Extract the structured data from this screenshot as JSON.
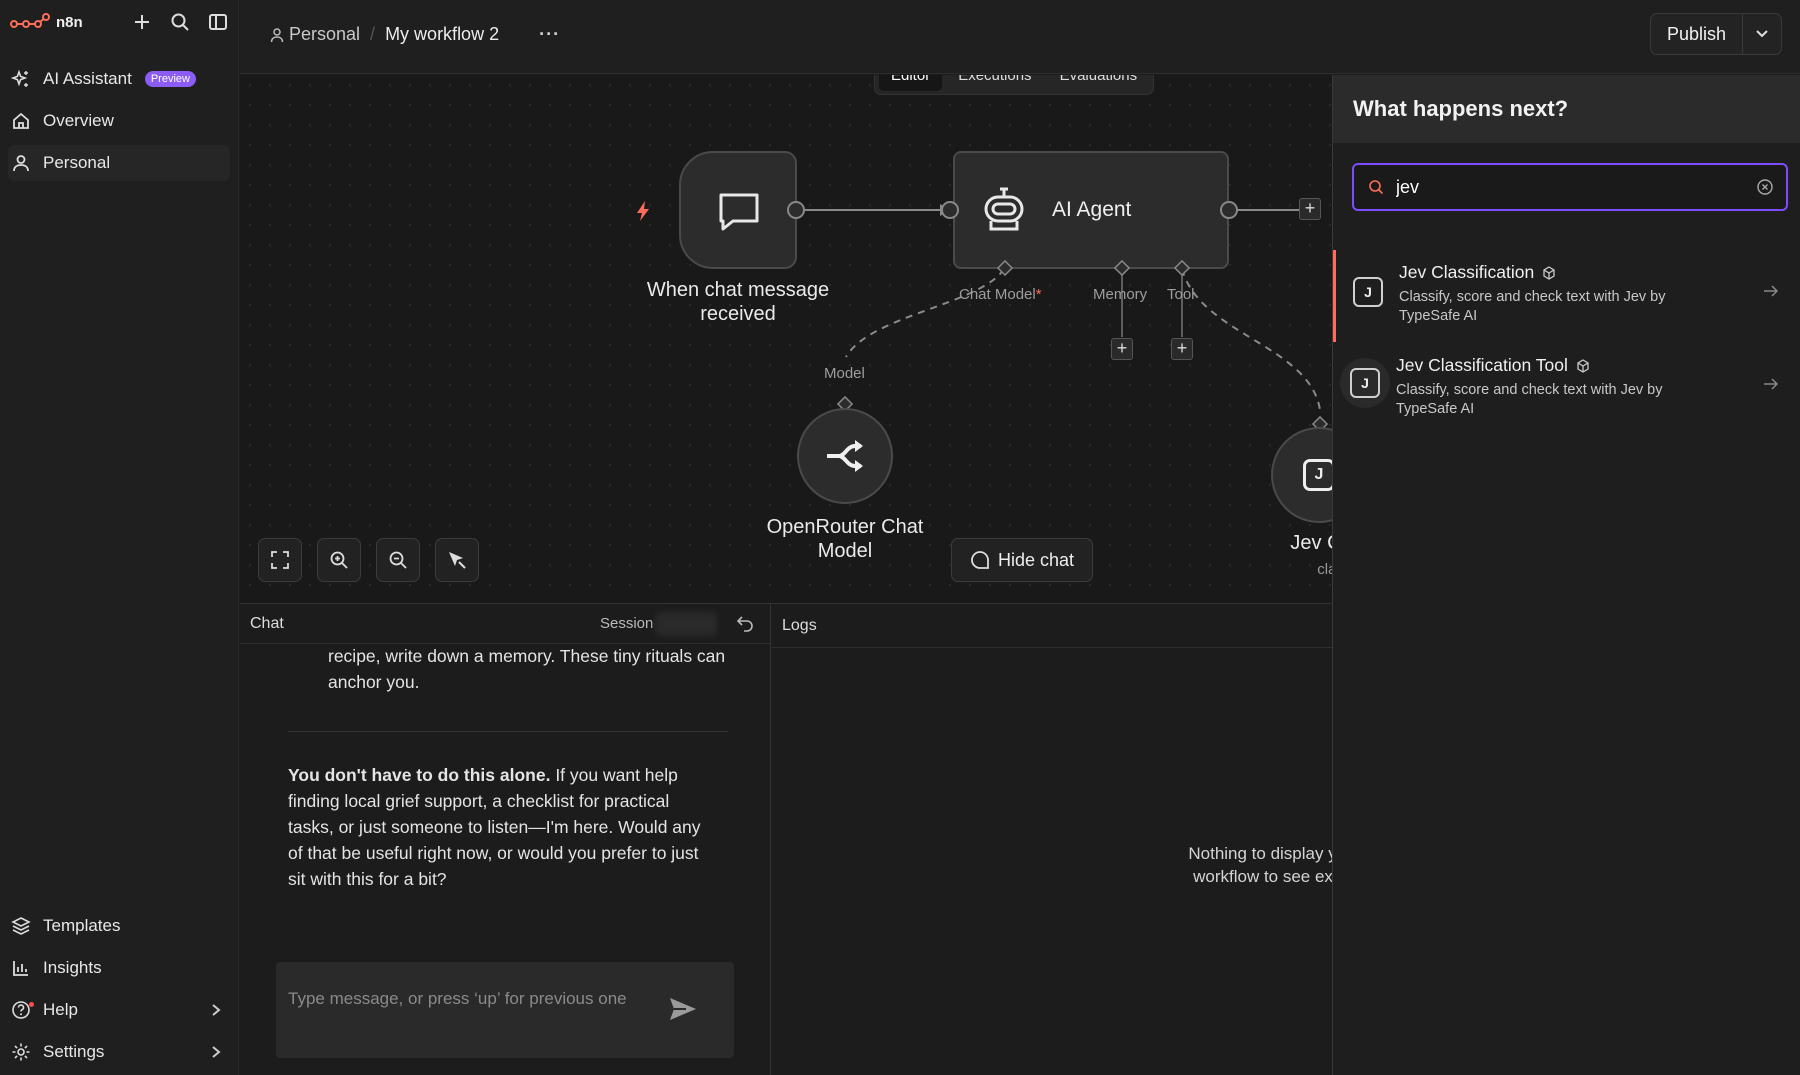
{
  "app": {
    "brand": "n8n",
    "accent_color": "#ff6d5a",
    "focus_color": "#7c4dff"
  },
  "sidebar": {
    "top_icons": [
      "plus-icon",
      "search-icon",
      "panel-toggle-icon"
    ],
    "items": [
      {
        "label": "AI Assistant",
        "badge": "Preview",
        "icon": "sparkle-icon"
      },
      {
        "label": "Overview",
        "icon": "home-icon"
      },
      {
        "label": "Personal",
        "icon": "user-icon"
      }
    ],
    "bottom_items": [
      {
        "label": "Templates",
        "icon": "templates-icon"
      },
      {
        "label": "Insights",
        "icon": "chart-icon"
      },
      {
        "label": "Help",
        "icon": "help-icon"
      },
      {
        "label": "Settings",
        "icon": "gear-icon"
      }
    ]
  },
  "header": {
    "project": "Personal",
    "workflow_name": "My workflow 2",
    "more": "···",
    "publish_label": "Publish"
  },
  "tabs": [
    "Editor",
    "Executions",
    "Evaluations"
  ],
  "canvas": {
    "nodes": {
      "trigger": "When chat message received",
      "agent": "AI Agent",
      "model": "OpenRouter Chat Model",
      "jev": "Jev Classi",
      "jev_sub": "classi"
    },
    "ports": {
      "chat_model": "Chat Model",
      "memory": "Memory",
      "tool": "Tool",
      "model": "Model"
    },
    "hide_chat": "Hide chat"
  },
  "chat": {
    "title": "Chat",
    "session_label": "Session",
    "message_cut": "recipe, write down a memory. These tiny rituals can anchor you.",
    "message_bold": "You don't have to do this alone.",
    "message_rest": " If you want help finding local grief support, a checklist for practical tasks, or just someone to listen—I'm here. Would any of that be useful right now, or would you prefer to just sit with this for a bit?",
    "input_placeholder": "Type message, or press ‘up’ for previous one"
  },
  "logs": {
    "title": "Logs",
    "empty_line1": "Nothing to display yet.",
    "empty_line2": "workflow to see exec"
  },
  "node_panel": {
    "title": "What happens next?",
    "search_value": "jev",
    "results": [
      {
        "title": "Jev Classification",
        "description": "Classify, score and check text with Jev by TypeSafe AI"
      },
      {
        "title": "Jev Classification Tool",
        "description": "Classify, score and check text with Jev by TypeSafe AI"
      }
    ]
  }
}
